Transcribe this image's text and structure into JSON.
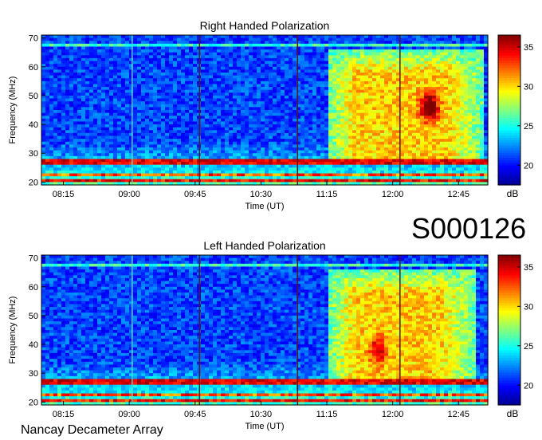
{
  "figure": {
    "observation_id": "S000126",
    "footer": "Nancay Decameter Array"
  },
  "colors": {
    "colormap": [
      "#00008f",
      "#0000ff",
      "#0080ff",
      "#00ffff",
      "#80ff80",
      "#ffff00",
      "#ff8000",
      "#ff0000",
      "#800000"
    ],
    "marker_line_cyan": "#4fd6d6",
    "marker_line_dark": "#5a1616"
  },
  "chart_data": [
    {
      "type": "heatmap",
      "title": "Right Handed Polarization",
      "xlabel": "Time (UT)",
      "ylabel": "Frequency (MHz)",
      "x_ticks": [
        "08:15",
        "09:00",
        "09:45",
        "10:30",
        "11:15",
        "12:00",
        "12:45"
      ],
      "x_range": [
        "08:00",
        "13:05"
      ],
      "y_ticks": [
        20,
        30,
        40,
        50,
        60,
        70
      ],
      "ylim": [
        19,
        71
      ],
      "colorbar": {
        "label": "dB",
        "ticks": [
          20,
          25,
          30,
          35
        ],
        "range": [
          17.5,
          36.5
        ]
      },
      "vertical_markers": [
        "09:02",
        "09:48",
        "10:55",
        "12:05"
      ],
      "emission": {
        "start": "11:25",
        "end": "12:50",
        "freq_range": [
          30,
          66
        ],
        "peak_time": "12:25",
        "peak_freq": 46,
        "peak_db": 35
      }
    },
    {
      "type": "heatmap",
      "title": "Left Handed Polarization",
      "xlabel": "Time (UT)",
      "ylabel": "Frequency (MHz)",
      "x_ticks": [
        "08:15",
        "09:00",
        "09:45",
        "10:30",
        "11:15",
        "12:00",
        "12:45"
      ],
      "x_range": [
        "08:00",
        "13:05"
      ],
      "y_ticks": [
        20,
        30,
        40,
        50,
        60,
        70
      ],
      "ylim": [
        19,
        71
      ],
      "colorbar": {
        "label": "dB",
        "ticks": [
          20,
          25,
          30,
          35
        ],
        "range": [
          17.5,
          36.5
        ]
      },
      "vertical_markers": [
        "09:02",
        "09:48",
        "10:55",
        "12:05"
      ],
      "emission": {
        "start": "11:25",
        "end": "12:45",
        "freq_range": [
          30,
          66
        ],
        "peak_time": "11:50",
        "peak_freq": 38,
        "peak_db": 31
      }
    }
  ]
}
